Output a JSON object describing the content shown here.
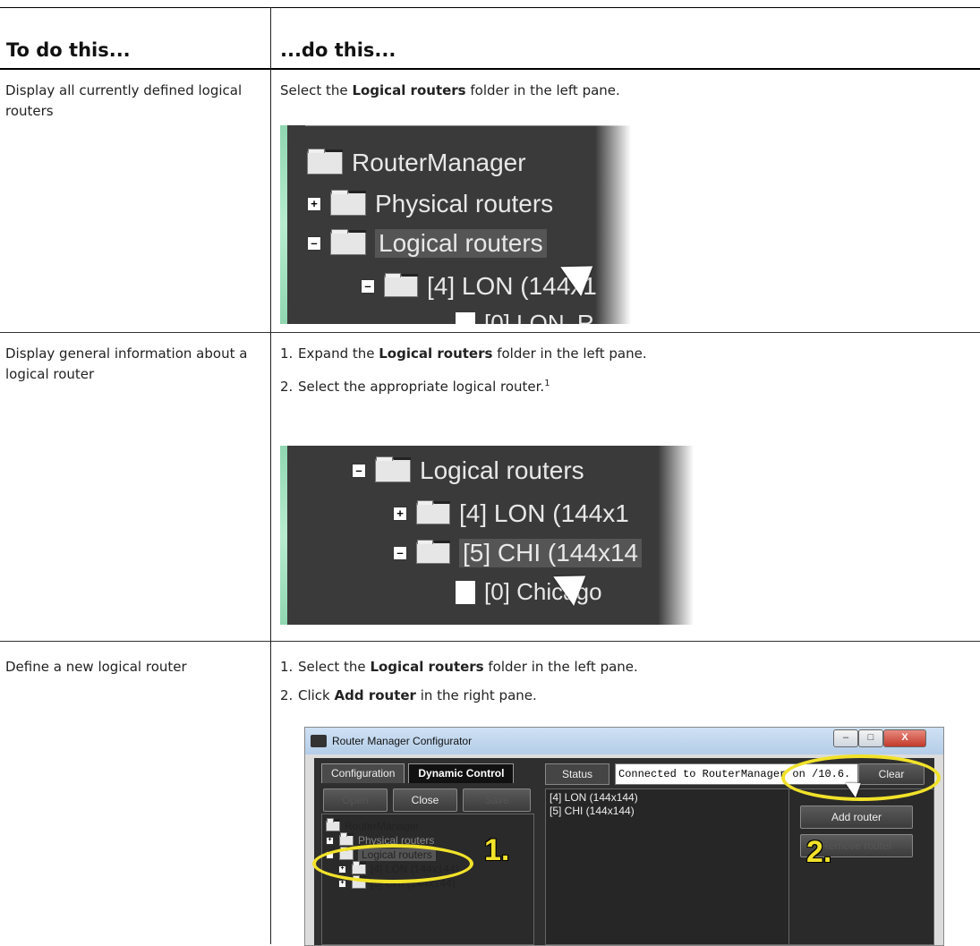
{
  "table": {
    "header": {
      "col1": "To do this...",
      "col2": "...do this..."
    },
    "rows": [
      {
        "task": "Display all currently defined logical routers",
        "steps": [
          {
            "pre": "Select the ",
            "bold": "Logical routers",
            "post": " folder in the left pane."
          }
        ]
      },
      {
        "task": "Display general information about a logical router",
        "steps": [
          {
            "num": "1.",
            "pre": "Expand the ",
            "bold": "Logical routers",
            "post": " folder in the left pane."
          },
          {
            "num": "2.",
            "pre": "Select the appropriate logical router.",
            "bold": "",
            "post": "",
            "sup": "1"
          }
        ]
      },
      {
        "task": "Define a new logical router",
        "steps": [
          {
            "num": "1.",
            "pre": "Select the ",
            "bold": "Logical routers",
            "post": " folder in the left pane."
          },
          {
            "num": "2.",
            "pre": "Click ",
            "bold": "Add router",
            "post": " in the right pane."
          }
        ]
      }
    ]
  },
  "shot1": {
    "items": [
      "RouterManager",
      "Physical routers",
      "Logical routers",
      "[4] LON (144x1",
      "[0] LON_R"
    ]
  },
  "shot2": {
    "items": [
      "Logical routers",
      "[4] LON (144x1",
      "[5] CHI (144x14",
      "[0] Chicago"
    ]
  },
  "app": {
    "title": "Router Manager Configurator",
    "window_buttons": {
      "minimize": "–",
      "maximize": "□",
      "close": "X"
    },
    "tabs": [
      "Configuration",
      "Dynamic Control"
    ],
    "buttons": {
      "open": "Open",
      "close": "Close",
      "save": "Save"
    },
    "tree": [
      "RouterManager",
      "Physical routers",
      "Logical routers",
      "[4] LON (144x144)",
      "[5] CHI (144x144)"
    ],
    "status_label": "Status",
    "status_text": "Connected to RouterManager on /10.6.",
    "clear_label": "Clear",
    "list": [
      "[4] LON (144x144)",
      "[5] CHI (144x144)"
    ],
    "add_router": "Add router",
    "remove_router": "Remove router",
    "callouts": [
      "1.",
      "2."
    ],
    "accent": "#f1e22a"
  }
}
